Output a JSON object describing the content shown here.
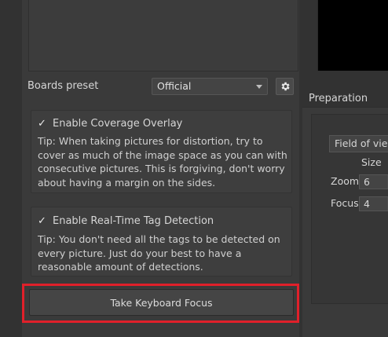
{
  "left": {
    "boards_preset_label": "Boards preset",
    "boards_preset_value": "Official",
    "coverage": {
      "checkbox_label": "Enable Coverage Overlay",
      "checked": true,
      "tip": "Tip: When taking pictures for distortion, try to cover as much of the image space as you can with consecutive pictures. This is forgiving, don't worry about having a margin on the sides."
    },
    "tag_detection": {
      "checkbox_label": "Enable Real-Time Tag Detection",
      "checked": true,
      "tip": "Tip: You don't need all the tags to be detected on every picture. Just do your best to have a reasonable amount of detections."
    },
    "focus_button_label": "Take Keyboard Focus"
  },
  "right": {
    "preparation_label": "Preparation",
    "field_of_view_label": "Field of view",
    "size_label": "Size",
    "zoom_label": "Zoom",
    "zoom_value": "6",
    "focus_label": "Focus",
    "focus_value": "4"
  },
  "colors": {
    "highlight": "#e0202a"
  }
}
